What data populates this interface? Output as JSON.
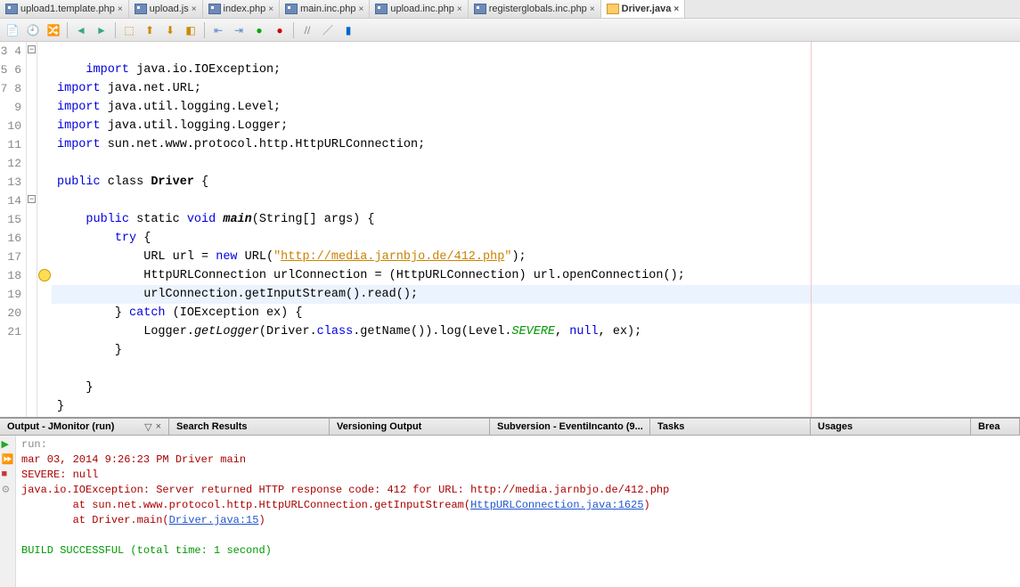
{
  "tabs": [
    {
      "label": "upload1.template.php",
      "type": "php"
    },
    {
      "label": "upload.js",
      "type": "php"
    },
    {
      "label": "index.php",
      "type": "php"
    },
    {
      "label": "main.inc.php",
      "type": "php"
    },
    {
      "label": "upload.inc.php",
      "type": "php"
    },
    {
      "label": "registerglobals.inc.php",
      "type": "php"
    },
    {
      "label": "Driver.java",
      "type": "java",
      "active": true
    }
  ],
  "lineStart": 3,
  "lineEnd": 21,
  "code": {
    "l3": {
      "kw": "import",
      "rest": " java.io.IOException;"
    },
    "l4": {
      "kw": "import",
      "rest": " java.net.URL;"
    },
    "l5": {
      "kw": "import",
      "rest": " java.util.logging.Level;"
    },
    "l6": {
      "kw": "import",
      "rest": " java.util.logging.Logger;"
    },
    "l7": {
      "kw": "import",
      "rest": " sun.net.www.protocol.http.HttpURLConnection;"
    },
    "l9a": "public",
    "l9b": " class ",
    "l9c": "Driver",
    "l9d": " {",
    "l11a": "public",
    "l11b": " static ",
    "l11c": "void",
    "l11d": " ",
    "l11e": "main",
    "l11f": "(String[] args) {",
    "l12a": "try",
    "l12b": " {",
    "l13a": "URL url = ",
    "l13b": "new",
    "l13c": " URL(",
    "l13d": "\"",
    "l13e": "http://media.jarnbjo.de/412.php",
    "l13f": "\"",
    "l13g": ");",
    "l14": "HttpURLConnection urlConnection = (HttpURLConnection) url.openConnection();",
    "l15": "urlConnection.getInputStream().read();",
    "l16a": "} ",
    "l16b": "catch",
    "l16c": " (IOException ex) {",
    "l17a": "Logger.",
    "l17b": "getLogger",
    "l17c": "(Driver.",
    "l17d": "class",
    "l17e": ".getName()).log(Level.",
    "l17f": "SEVERE",
    "l17g": ", ",
    "l17h": "null",
    "l17i": ", ex);",
    "l18": "}",
    "l20": "}",
    "l21": "}"
  },
  "panels": {
    "p0": "Output - JMonitor (run)",
    "p1": "Search Results",
    "p2": "Versioning Output",
    "p3": "Subversion - EventiIncanto (9...",
    "p4": "Tasks",
    "p5": "Usages",
    "p6": "Brea"
  },
  "output": {
    "run": "run:",
    "l1": "mar 03, 2014 9:26:23 PM Driver main",
    "l2": "SEVERE: null",
    "l3": "java.io.IOException: Server returned HTTP response code: 412 for URL: http://media.jarnbjo.de/412.php",
    "l4a": "        at sun.net.www.protocol.http.HttpURLConnection.getInputStream(",
    "l4b": "HttpURLConnection.java:1625",
    "l4c": ")",
    "l5a": "        at Driver.main(",
    "l5b": "Driver.java:15",
    "l5c": ")",
    "build": "BUILD SUCCESSFUL (total time: 1 second)"
  }
}
